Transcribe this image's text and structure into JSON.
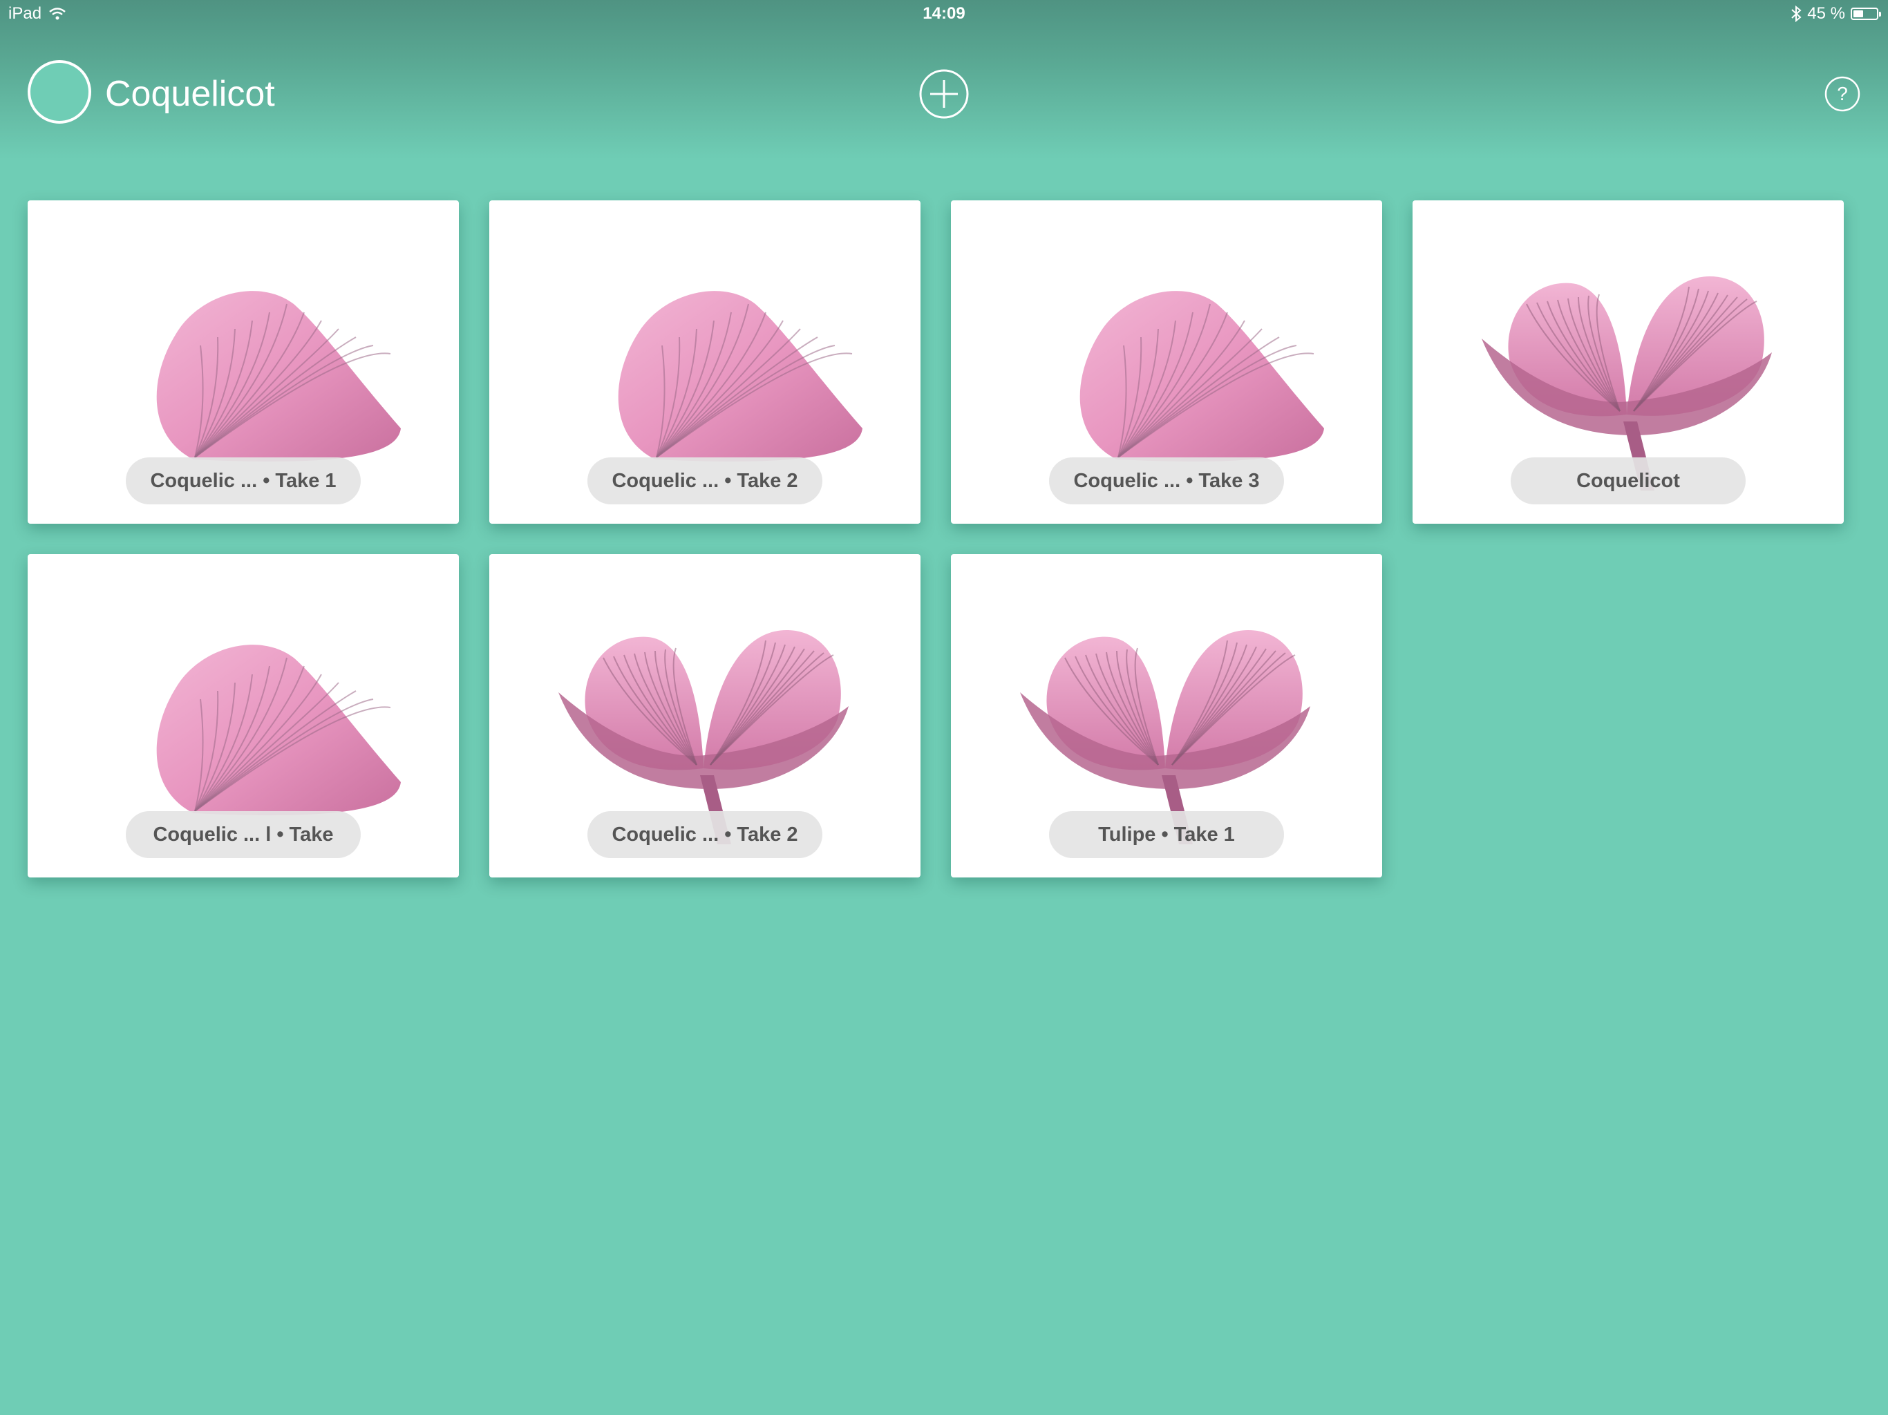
{
  "status_bar": {
    "device": "iPad",
    "time": "14:09",
    "battery_percent": "45 %",
    "battery_level": 0.45
  },
  "nav": {
    "title": "Coquelicot",
    "add_icon": "plus-circle-icon",
    "help_icon": "question-circle-icon"
  },
  "colors": {
    "background": "#6fcdb5",
    "petal": "#e896c0"
  },
  "cards": [
    {
      "label": "Coquelic ... • Take 1",
      "thumbnail": "single-petal"
    },
    {
      "label": "Coquelic ... • Take 2",
      "thumbnail": "single-petal"
    },
    {
      "label": "Coquelic ... • Take 3",
      "thumbnail": "single-petal"
    },
    {
      "label": "Coquelicot",
      "thumbnail": "flower"
    },
    {
      "label": "Coquelic ... l • Take",
      "thumbnail": "single-petal"
    },
    {
      "label": "Coquelic ... • Take 2",
      "thumbnail": "flower"
    },
    {
      "label": "Tulipe • Take 1",
      "thumbnail": "flower"
    }
  ]
}
